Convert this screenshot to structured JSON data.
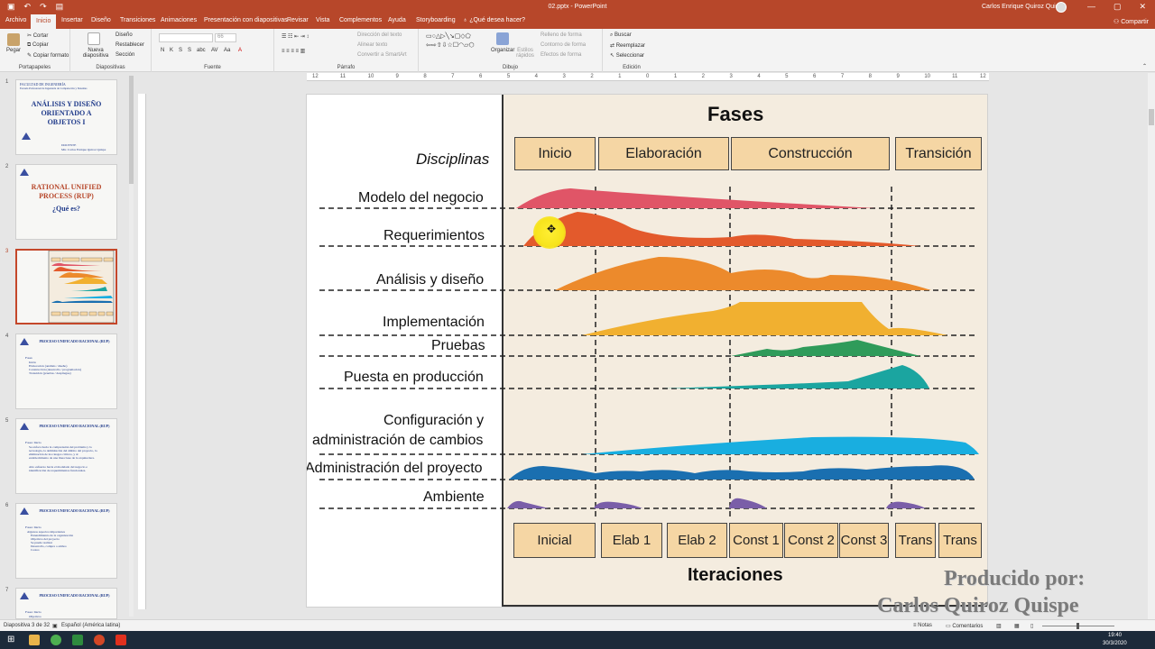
{
  "window": {
    "title": "02.pptx - PowerPoint",
    "user": "Carlos Enrique Quiroz Quispe",
    "controls": [
      "—",
      "▢",
      "✕"
    ]
  },
  "qat_icons": [
    "save-icon",
    "undo-icon",
    "redo-icon",
    "present-icon"
  ],
  "tabs": [
    {
      "label": "Archivo",
      "active": false
    },
    {
      "label": "Inicio",
      "active": true
    },
    {
      "label": "Insertar",
      "active": false
    },
    {
      "label": "Diseño",
      "active": false
    },
    {
      "label": "Transiciones",
      "active": false
    },
    {
      "label": "Animaciones",
      "active": false
    },
    {
      "label": "Presentación con diapositivas",
      "active": false
    },
    {
      "label": "Revisar",
      "active": false
    },
    {
      "label": "Vista",
      "active": false
    },
    {
      "label": "Complementos",
      "active": false
    },
    {
      "label": "Ayuda",
      "active": false
    },
    {
      "label": "Storyboarding",
      "active": false
    },
    {
      "label": "¿Qué desea hacer?",
      "active": false
    }
  ],
  "share_label": "Compartir",
  "ribbon": {
    "portapapeles": {
      "label": "Portapapeles",
      "paste": "Pegar",
      "cut": "Cortar",
      "copy": "Copiar",
      "format": "Copiar formato"
    },
    "diapositivas": {
      "label": "Diapositivas",
      "new": "Nueva diapositiva",
      "layout": "Diseño",
      "reset": "Restablecer",
      "section": "Sección"
    },
    "fuente": {
      "label": "Fuente",
      "size": "66",
      "buttons": [
        "N",
        "K",
        "S",
        "S",
        "abc",
        "AV",
        "Aa",
        "A"
      ]
    },
    "parrafo": {
      "label": "Párrafo",
      "dir": "Dirección del texto",
      "align": "Alinear texto",
      "smartart": "Convertir a SmartArt"
    },
    "dibujo": {
      "label": "Dibujo",
      "arrange": "Organizar",
      "styles": "Estilos rápidos",
      "fill": "Relleno de forma",
      "outline": "Contorno de forma",
      "effects": "Efectos de forma"
    },
    "edicion": {
      "label": "Edición",
      "find": "Buscar",
      "replace": "Reemplazar",
      "select": "Seleccionar"
    }
  },
  "ruler_ticks": [
    "12",
    "11",
    "10",
    "9",
    "8",
    "7",
    "6",
    "5",
    "4",
    "3",
    "2",
    "1",
    "0",
    "1",
    "2",
    "3",
    "4",
    "5",
    "6",
    "7",
    "8",
    "9",
    "10",
    "11",
    "12"
  ],
  "thumbnails": [
    {
      "num": "1",
      "title": "ANÁLISIS Y DISEÑO ORIENTADO A OBJETOS I",
      "header": "FACULTAD DE INGENIERÍA",
      "sub": "Escuela Profesional de Ingeniería de Computación y Sistemas",
      "lines": [
        "DOCENTE",
        "Mtr. Carlos Enrique Quiroz Quispe"
      ]
    },
    {
      "num": "2",
      "title": "RATIONAL UNIFIED PROCESS (RUP)",
      "subtitle": "¿Qué es?"
    },
    {
      "num": "3",
      "title": "Fases",
      "active": true
    },
    {
      "num": "4",
      "title": "PROCESO UNIFICADO RACIONAL (RUP)",
      "lines": [
        "Fases",
        "Inicio",
        "Elaboración (análisis / diseño)",
        "Construcción (desarrollo / programación)",
        "Transición (pruebas / despliegue)"
      ]
    },
    {
      "num": "5",
      "title": "PROCESO UNIFICADO RACIONAL (RUP)",
      "lines": [
        "Fases: Inicio",
        "Se enfoca hacia la comprensión del problema y la",
        "tecnología, la delimitación del ámbito del proyecto, la",
        "eliminación de los riesgos críticos, y al",
        "establecimiento de una línea base de la arquitectura.",
        "Alto esfuerzo hacia el modelado del negocio e",
        "identificación de requerimientos funcionales."
      ]
    },
    {
      "num": "6",
      "title": "PROCESO UNIFICADO RACIONAL (RUP)",
      "lines": [
        "Fases: Inicio",
        "Algunos aspectos importantes",
        "Entendimiento de la organización",
        "Objetivos del proyecto",
        "Se puede realizar",
        "Desarrollo, compra o ambos",
        "Costos"
      ]
    },
    {
      "num": "7",
      "title": "PROCESO UNIFICADO RACIONAL (RUP)",
      "lines": [
        "Fases: Inicio",
        "Objetivos"
      ]
    }
  ],
  "slide": {
    "fases_title": "Fases",
    "disciplinas_label": "Disciplinas",
    "phases": [
      "Inicio",
      "Elaboración",
      "Construcción",
      "Transición"
    ],
    "disciplines": [
      {
        "label": "Modelo del negocio",
        "color": "#e05567"
      },
      {
        "label": "Requerimientos",
        "color": "#e35a2c"
      },
      {
        "label": "Análisis y diseño",
        "color": "#ec8a2c"
      },
      {
        "label": "Implementación",
        "color": "#f1b030"
      },
      {
        "label": "Pruebas",
        "color": "#2f9b5a"
      },
      {
        "label": "Puesta en producción",
        "color": "#1ba5a0"
      },
      {
        "label": "Configuración y",
        "color": "#19aee0"
      },
      {
        "label": "administración de cambios",
        "color": "#19aee0"
      },
      {
        "label": "Administración del proyecto",
        "color": "#1a6fb0"
      },
      {
        "label": "Ambiente",
        "color": "#7a5ea8"
      }
    ],
    "iterations": [
      "Inicial",
      "Elab 1",
      "Elab 2",
      "Const 1",
      "Const 2",
      "Const 3",
      "Trans",
      "Trans"
    ],
    "iteraciones_title": "Iteraciones"
  },
  "watermark": {
    "line1": "Producido por:",
    "line2": "Carlos Quiroz Quispe"
  },
  "status": {
    "slide_count": "Diapositiva 3 de 32",
    "language": "Español (América latina)",
    "notes": "Notas",
    "comments": "Comentarios"
  },
  "taskbar": {
    "time": "19:40",
    "date": "30/3/2020",
    "apps": [
      "start-icon",
      "file-explorer-icon",
      "chrome-icon",
      "camtasia-icon",
      "powerpoint-icon",
      "recorder-icon"
    ]
  }
}
